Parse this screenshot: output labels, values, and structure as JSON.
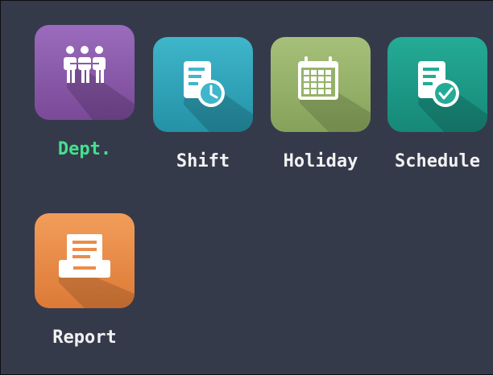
{
  "menu": {
    "items": [
      {
        "label": "Dept.",
        "icon": "dept-people-icon",
        "color": "#8a5aa8",
        "active": true
      },
      {
        "label": "Shift",
        "icon": "shift-clock-document-icon",
        "color": "#2aa6bb",
        "active": false
      },
      {
        "label": "Holiday",
        "icon": "holiday-calendar-icon",
        "color": "#96b26a",
        "active": false
      },
      {
        "label": "Schedule",
        "icon": "schedule-check-document-icon",
        "color": "#1c9a86",
        "active": false
      },
      {
        "label": "Report",
        "icon": "report-tray-icon",
        "color": "#ec8c48",
        "active": false
      }
    ]
  },
  "colors": {
    "background": "#353a4b",
    "label_text": "#f2f2f2",
    "active_label": "#42e28c"
  }
}
